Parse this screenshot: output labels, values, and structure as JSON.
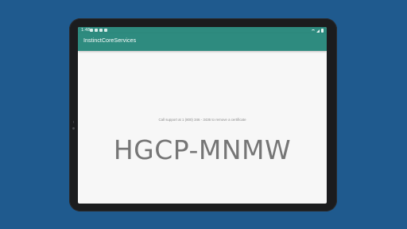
{
  "status_bar": {
    "time": "1:48",
    "left_icons": [
      "notification-icon",
      "notification-icon",
      "notification-icon",
      "notification-icon"
    ],
    "right_icons": [
      "wifi-icon",
      "signal-icon",
      "battery-icon"
    ]
  },
  "app_bar": {
    "title": "InstinctCoreServices",
    "color": "#2e8b7f"
  },
  "main": {
    "support_text": "Call support at 1 (800) 346 - 3436 to remove a certificate",
    "code": "HGCP-MNMW"
  },
  "colors": {
    "background": "#1f5a8e",
    "accent": "#2e8b7f",
    "screen": "#f7f7f7"
  }
}
